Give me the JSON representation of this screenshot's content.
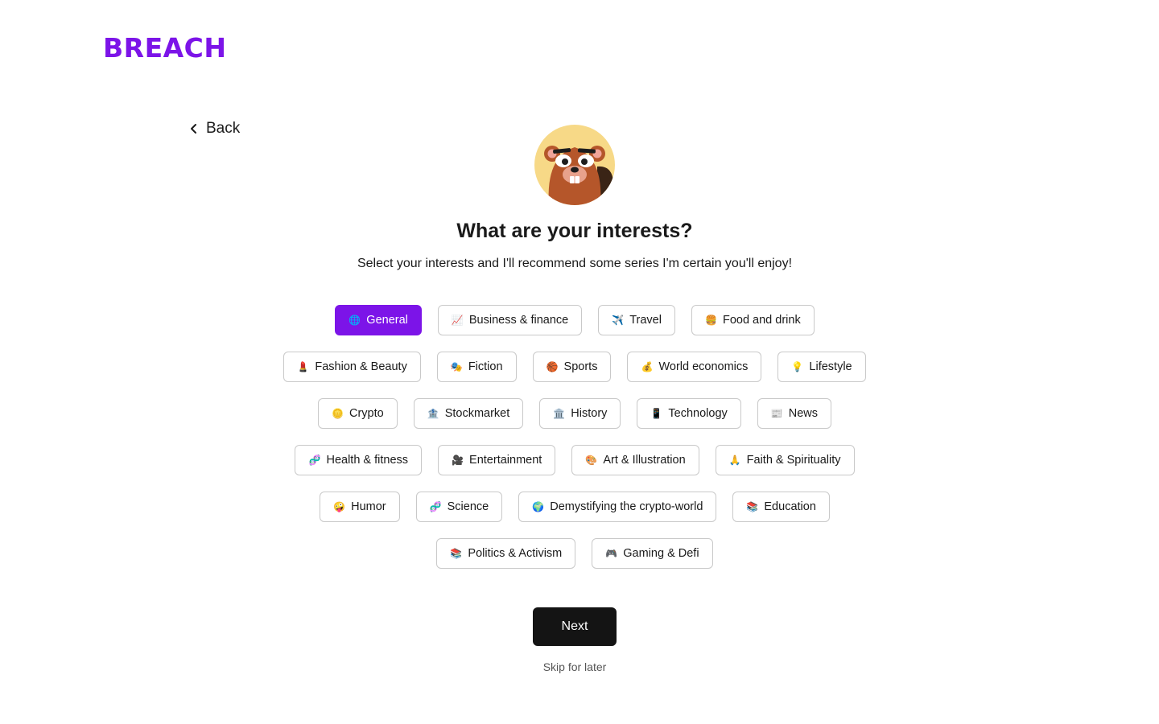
{
  "brand": {
    "logo_text": "BREACH",
    "accent_color": "#7c14e8"
  },
  "nav": {
    "back_label": "Back",
    "back_icon": "chevron-left-icon"
  },
  "avatar": {
    "icon": "beaver-mascot"
  },
  "header": {
    "title": "What are your interests?",
    "subtitle": "Select your interests and I'll recommend some series I'm certain you'll enjoy!"
  },
  "interests": {
    "rows": [
      [
        {
          "emoji": "🌐",
          "label": "General",
          "selected": true
        },
        {
          "emoji": "📈",
          "label": "Business & finance",
          "selected": false
        },
        {
          "emoji": "✈️",
          "label": "Travel",
          "selected": false
        },
        {
          "emoji": "🍔",
          "label": "Food and drink",
          "selected": false
        }
      ],
      [
        {
          "emoji": "💄",
          "label": "Fashion & Beauty",
          "selected": false
        },
        {
          "emoji": "🎭",
          "label": "Fiction",
          "selected": false
        },
        {
          "emoji": "🏀",
          "label": "Sports",
          "selected": false
        },
        {
          "emoji": "💰",
          "label": "World economics",
          "selected": false
        },
        {
          "emoji": "💡",
          "label": "Lifestyle",
          "selected": false
        }
      ],
      [
        {
          "emoji": "🪙",
          "label": "Crypto",
          "selected": false
        },
        {
          "emoji": "🏦",
          "label": "Stockmarket",
          "selected": false
        },
        {
          "emoji": "🏛️",
          "label": "History",
          "selected": false
        },
        {
          "emoji": "📱",
          "label": "Technology",
          "selected": false
        },
        {
          "emoji": "📰",
          "label": "News",
          "selected": false
        }
      ],
      [
        {
          "emoji": "🧬",
          "label": "Health & fitness",
          "selected": false
        },
        {
          "emoji": "🎥",
          "label": "Entertainment",
          "selected": false
        },
        {
          "emoji": "🎨",
          "label": "Art & Illustration",
          "selected": false
        },
        {
          "emoji": "🙏",
          "label": "Faith & Spirituality",
          "selected": false
        }
      ],
      [
        {
          "emoji": "🤪",
          "label": "Humor",
          "selected": false
        },
        {
          "emoji": "🧬",
          "label": "Science",
          "selected": false
        },
        {
          "emoji": "🌍",
          "label": "Demystifying the crypto-world",
          "selected": false
        },
        {
          "emoji": "📚",
          "label": "Education",
          "selected": false
        }
      ],
      [
        {
          "emoji": "📚",
          "label": "Politics & Activism",
          "selected": false
        },
        {
          "emoji": "🎮",
          "label": "Gaming & Defi",
          "selected": false
        }
      ]
    ]
  },
  "actions": {
    "next_label": "Next",
    "skip_label": "Skip for later"
  }
}
